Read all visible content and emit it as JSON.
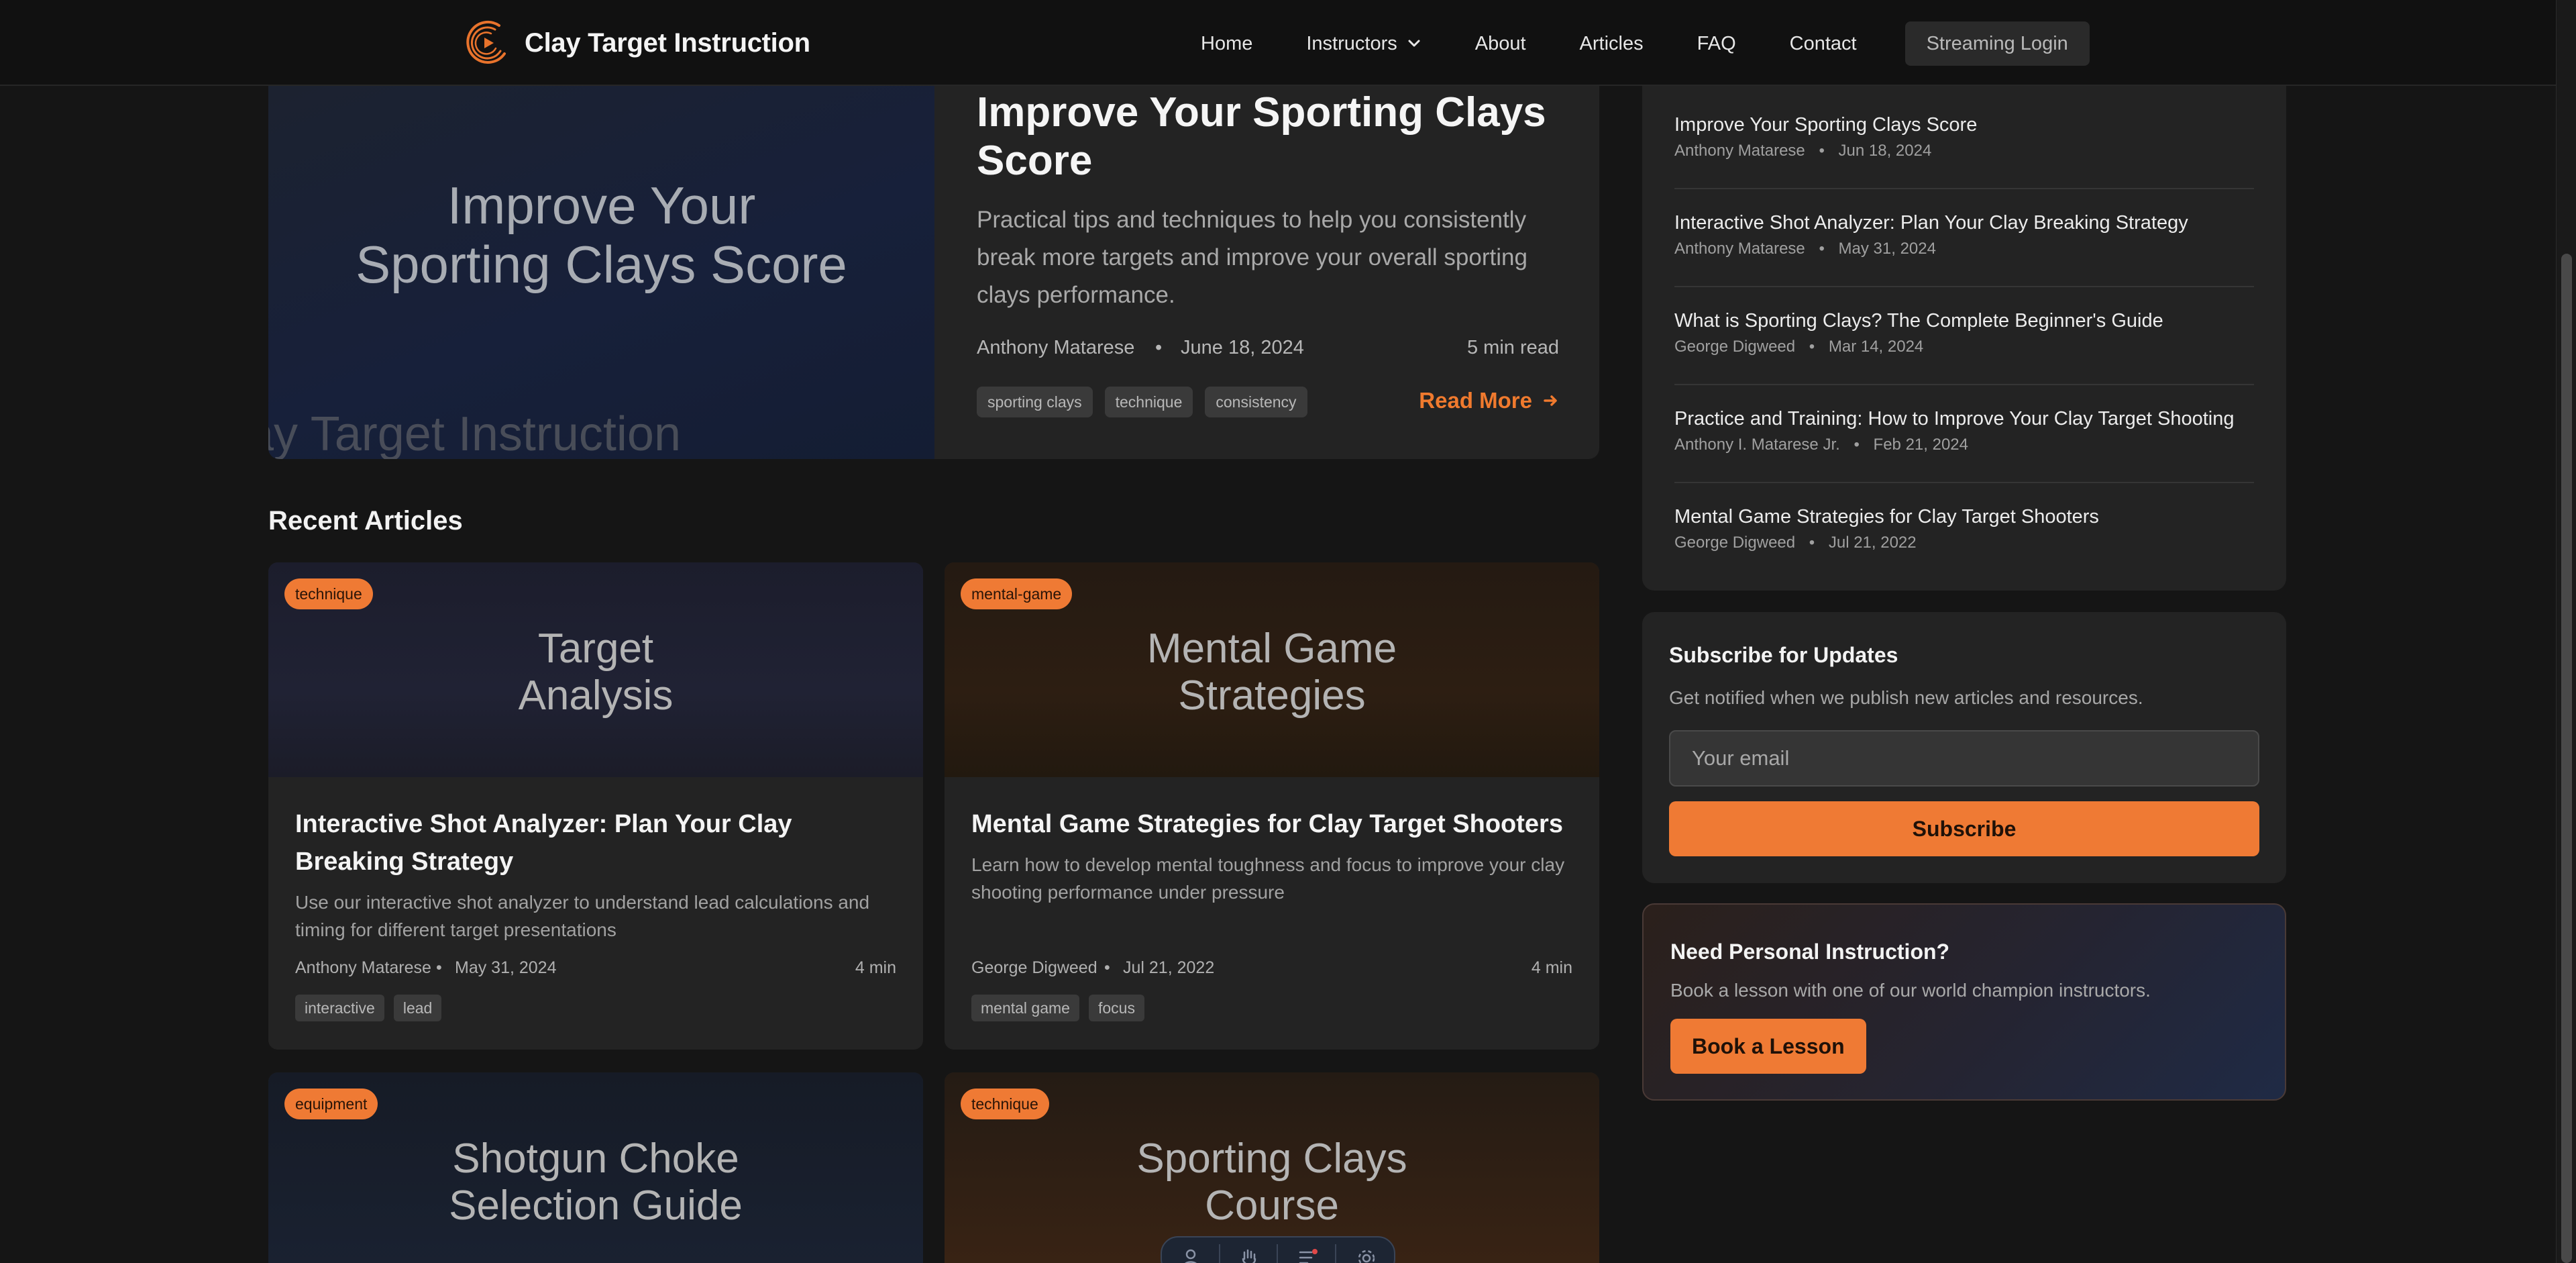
{
  "header": {
    "brand": "Clay Target Instruction",
    "nav": [
      {
        "label": "Home"
      },
      {
        "label": "Instructors"
      },
      {
        "label": "About"
      },
      {
        "label": "Articles"
      },
      {
        "label": "FAQ"
      },
      {
        "label": "Contact"
      }
    ],
    "streaming_login": "Streaming Login"
  },
  "featured": {
    "image_title_line1": "Improve Your",
    "image_title_line2": "Sporting Clays Score",
    "image_watermark": "ay Target Instruction",
    "title": "Improve Your Sporting Clays Score",
    "summary": "Practical tips and techniques to help you consistently break more targets and improve your overall sporting clays performance.",
    "author": "Anthony Matarese",
    "separator": "•",
    "date": "June 18, 2024",
    "read_time": "5 min read",
    "tags": [
      "sporting clays",
      "technique",
      "consistency"
    ],
    "read_more": "Read More"
  },
  "recent": {
    "heading": "Recent Articles",
    "cards": [
      {
        "category": "technique",
        "image_line1": "Target",
        "image_line2": "Analysis",
        "title": "Interactive Shot Analyzer: Plan Your Clay Breaking Strategy",
        "description": "Use our interactive shot analyzer to understand lead calculations and timing for different target presentations",
        "author": "Anthony Matarese",
        "date": "May 31, 2024",
        "read_time": "4 min",
        "tags": [
          "interactive",
          "lead"
        ]
      },
      {
        "category": "mental-game",
        "image_line1": "Mental Game",
        "image_line2": "Strategies",
        "title": "Mental Game Strategies for Clay Target Shooters",
        "description": "Learn how to develop mental toughness and focus to improve your clay shooting performance under pressure",
        "author": "George Digweed",
        "date": "Jul 21, 2022",
        "read_time": "4 min",
        "tags": [
          "mental game",
          "focus"
        ]
      },
      {
        "category": "equipment",
        "image_line1": "Shotgun Choke",
        "image_line2": "Selection Guide"
      },
      {
        "category": "technique",
        "image_line1": "Sporting Clays",
        "image_line2": "Course"
      }
    ]
  },
  "sidebar": {
    "popular": [
      {
        "title": "Improve Your Sporting Clays Score",
        "author": "Anthony Matarese",
        "date": "Jun 18, 2024"
      },
      {
        "title": "Interactive Shot Analyzer: Plan Your Clay Breaking Strategy",
        "author": "Anthony Matarese",
        "date": "May 31, 2024"
      },
      {
        "title": "What is Sporting Clays? The Complete Beginner's Guide",
        "author": "George Digweed",
        "date": "Mar 14, 2024"
      },
      {
        "title": "Practice and Training: How to Improve Your Clay Target Shooting",
        "author": "Anthony I. Matarese Jr.",
        "date": "Feb 21, 2024"
      },
      {
        "title": "Mental Game Strategies for Clay Target Shooters",
        "author": "George Digweed",
        "date": "Jul 21, 2022"
      }
    ],
    "subscribe": {
      "title": "Subscribe for Updates",
      "description": "Get notified when we publish new articles and resources.",
      "placeholder": "Your email",
      "button": "Subscribe"
    },
    "instruction": {
      "title": "Need Personal Instruction?",
      "description": "Book a lesson with one of our world champion instructors.",
      "button": "Book a Lesson"
    }
  },
  "theme": {
    "accent": "#ef7a34",
    "background": "#151515",
    "card": "#232323"
  },
  "icons": {
    "logo": "clay-target-logo-icon",
    "nav_dropdown": "chevron-down-icon",
    "read_more": "arrow-right-icon",
    "toolbar": [
      "user-icon",
      "hand-icon",
      "list-icon",
      "gear-icon"
    ]
  }
}
